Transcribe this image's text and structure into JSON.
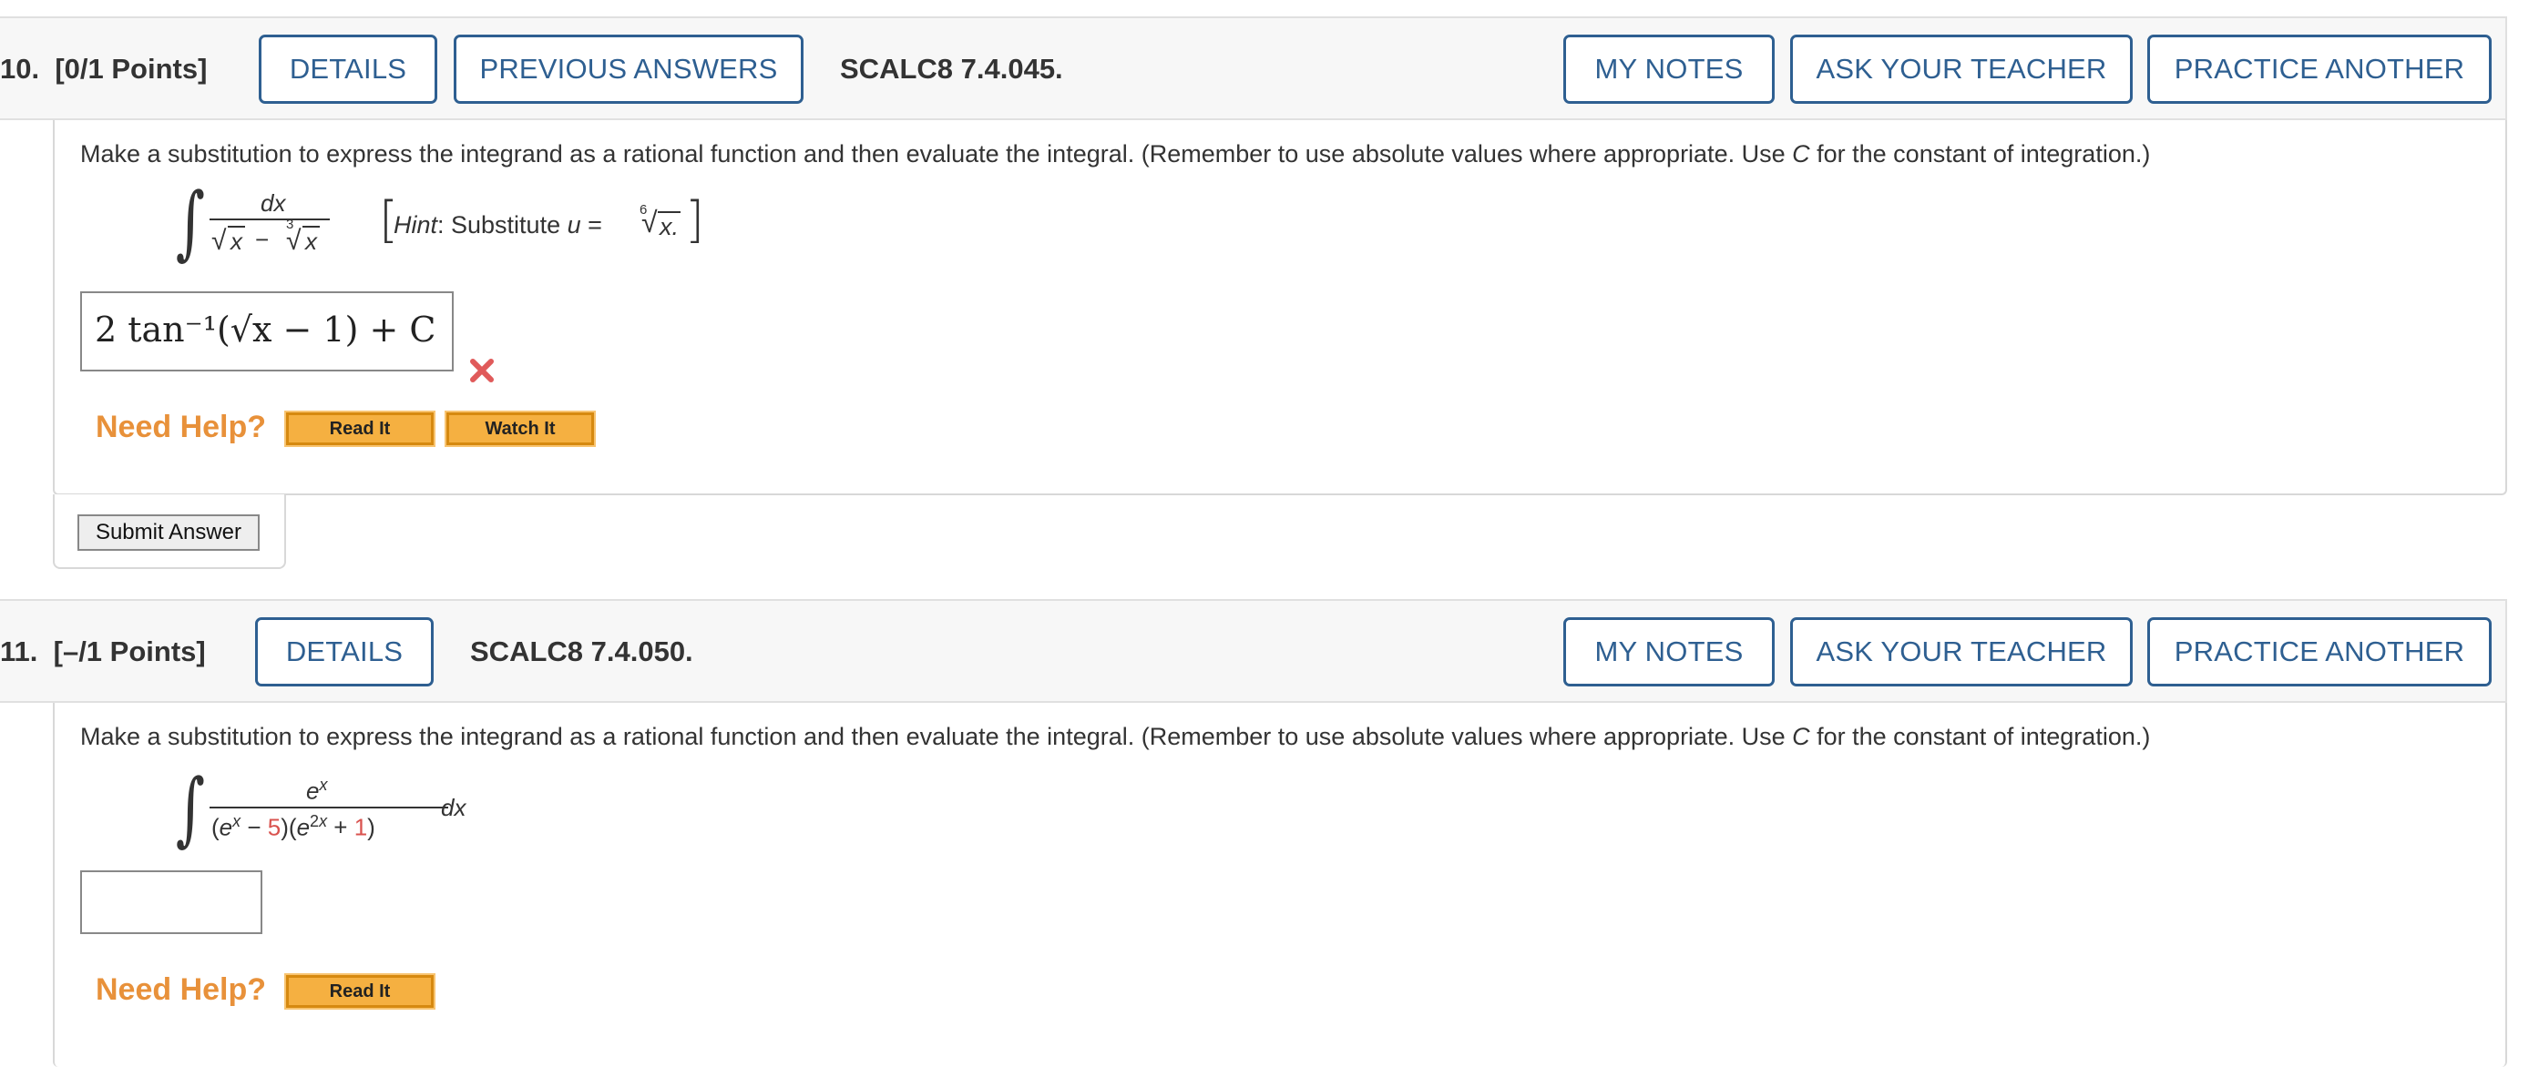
{
  "questions": [
    {
      "number": "10.",
      "points": "[0/1 Points]",
      "details_label": "DETAILS",
      "previous_label": "PREVIOUS ANSWERS",
      "code": "SCALC8 7.4.045.",
      "my_notes_label": "MY NOTES",
      "ask_teacher_label": "ASK YOUR TEACHER",
      "practice_label": "PRACTICE ANOTHER",
      "prompt_before_c": "Make a substitution to express the integrand as a rational function and then evaluate the integral. (Remember to use absolute values where appropriate. Use ",
      "prompt_c": "C",
      "prompt_after_c": " for the constant of integration.)",
      "integral_numerator": "dx",
      "hint_label": "Hint",
      "hint_text": ": Substitute ",
      "hint_var": "u",
      "hint_eq": " = ",
      "hint_root_index": "6",
      "hint_root_var": "x",
      "answer_value": "2 tan⁻¹(√x − 1) + C",
      "status": "incorrect",
      "need_help_label": "Need Help?",
      "read_it_label": "Read It",
      "watch_it_label": "Watch It",
      "submit_label": "Submit Answer"
    },
    {
      "number": "11.",
      "points": "[–/1 Points]",
      "details_label": "DETAILS",
      "code": "SCALC8 7.4.050.",
      "my_notes_label": "MY NOTES",
      "ask_teacher_label": "ASK YOUR TEACHER",
      "practice_label": "PRACTICE ANOTHER",
      "prompt_before_c": "Make a substitution to express the integrand as a rational function and then evaluate the integral. (Remember to use absolute values where appropriate. Use ",
      "prompt_c": "C",
      "prompt_after_c": " for the constant of integration.)",
      "integral_dx": "dx",
      "constant_a": "5",
      "constant_b": "1",
      "answer_value": "",
      "need_help_label": "Need Help?",
      "read_it_label": "Read It"
    }
  ],
  "colors": {
    "accent_blue": "#2e5f91",
    "help_orange": "#e8913a",
    "button_yellow": "#f5b041",
    "wrong_red": "#e05a5a",
    "highlight_red": "#d9534f"
  },
  "icons": {
    "incorrect": "x-mark-icon"
  }
}
